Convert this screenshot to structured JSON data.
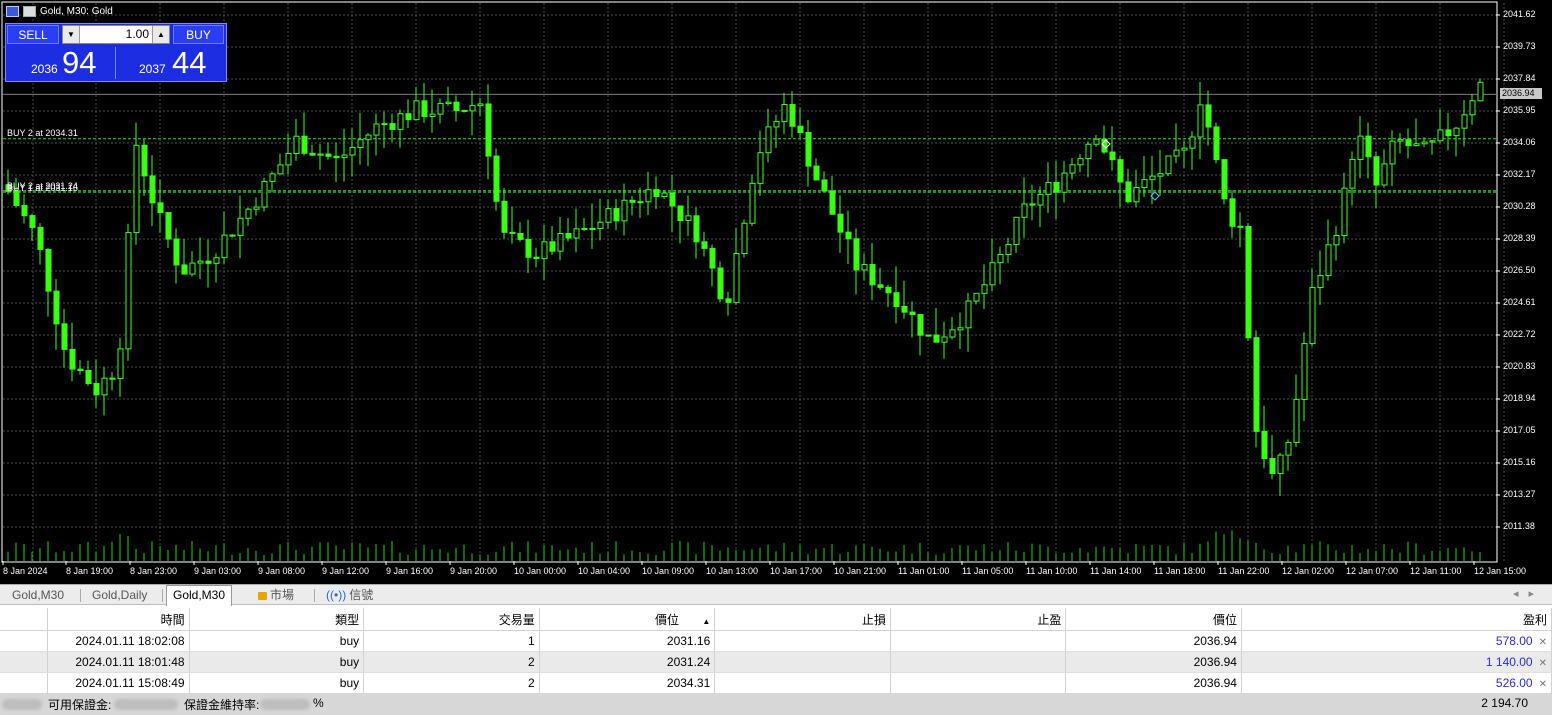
{
  "chart": {
    "title": "Gold, M30: Gold",
    "colors": {
      "background": "#000000",
      "candle": "#39ff14",
      "grid": "#4a4a4a",
      "volume": "#1fd20f",
      "order_line": "#2fe02f"
    },
    "trade_panel": {
      "sell_label": "SELL",
      "buy_label": "BUY",
      "lot": "1.00",
      "sell_small": "2036",
      "sell_big": "94",
      "buy_small": "2037",
      "buy_big": "44"
    },
    "orders": [
      {
        "label": "BUY 2 at 2034.31",
        "price": 2034.31
      },
      {
        "label": "BUY 2 at 2031.24",
        "price": 2031.24
      },
      {
        "label": "BUY 1 at 2031.16",
        "price": 2031.16
      }
    ],
    "current_price": "2036.94",
    "y_ticks": [
      "2041.62",
      "2039.73",
      "2037.84",
      "2035.95",
      "2034.06",
      "2032.17",
      "2030.28",
      "2028.39",
      "2026.50",
      "2024.61",
      "2022.72",
      "2020.83",
      "2018.94",
      "2017.05",
      "2015.16",
      "2013.27",
      "2011.38"
    ],
    "x_ticks": [
      "8 Jan 2024",
      "8 Jan 19:00",
      "8 Jan 23:00",
      "9 Jan 03:00",
      "9 Jan 08:00",
      "9 Jan 12:00",
      "9 Jan 16:00",
      "9 Jan 20:00",
      "10 Jan 00:00",
      "10 Jan 04:00",
      "10 Jan 09:00",
      "10 Jan 13:00",
      "10 Jan 17:00",
      "10 Jan 21:00",
      "11 Jan 01:00",
      "11 Jan 05:00",
      "11 Jan 10:00",
      "11 Jan 14:00",
      "11 Jan 18:00",
      "11 Jan 22:00",
      "12 Jan 02:00",
      "12 Jan 07:00",
      "12 Jan 11:00",
      "12 Jan 15:00"
    ]
  },
  "tabs": [
    {
      "label": "Gold,M30"
    },
    {
      "label": "Gold,Daily"
    },
    {
      "label": "Gold,M30",
      "active": true
    },
    {
      "label": "市場",
      "icon": "lock-icon"
    },
    {
      "label": "信號",
      "icon": "signal-icon"
    }
  ],
  "table": {
    "headers": [
      "時間",
      "類型",
      "交易量",
      "價位",
      "止損",
      "止盈",
      "價位",
      "盈利"
    ],
    "rows": [
      {
        "time": "2024.01.11 18:02:08",
        "type": "buy",
        "volume": "1",
        "price": "2031.16",
        "sl": "",
        "tp": "",
        "cur": "2036.94",
        "profit": "578.00"
      },
      {
        "time": "2024.01.11 18:01:48",
        "type": "buy",
        "volume": "2",
        "price": "2031.24",
        "sl": "",
        "tp": "",
        "cur": "2036.94",
        "profit": "1 140.00"
      },
      {
        "time": "2024.01.11 15:08:49",
        "type": "buy",
        "volume": "2",
        "price": "2034.31",
        "sl": "",
        "tp": "",
        "cur": "2036.94",
        "profit": "526.00"
      }
    ]
  },
  "status": {
    "free_margin_label": "可用保證金:",
    "margin_level_label": "保證金維持率:",
    "percent": "%",
    "total": "2 194.70"
  }
}
